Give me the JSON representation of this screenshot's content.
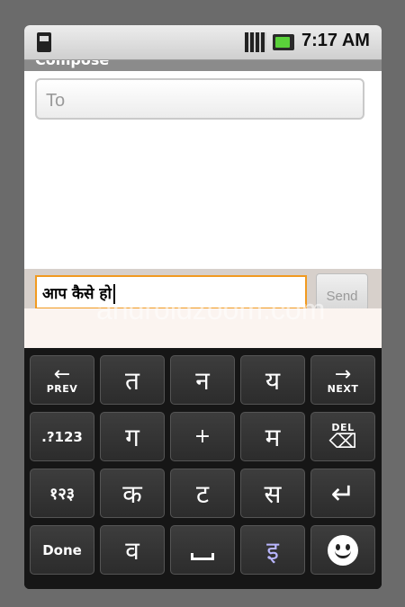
{
  "statusbar": {
    "time": "7:17 AM"
  },
  "title": {
    "text": "Compose"
  },
  "to_field": {
    "placeholder": "To"
  },
  "message": {
    "value": "आप कैसे हो"
  },
  "send_button": {
    "label": "Send"
  },
  "watermark": "androidzoom.com",
  "keyboard": {
    "row1": {
      "prev": "PREV",
      "k1": "त",
      "k2": "न",
      "k3": "य",
      "next": "NEXT"
    },
    "row2": {
      "sym": ".?123",
      "k1": "ग",
      "k2": "+",
      "k3": "म",
      "del": "DEL"
    },
    "row3": {
      "num": "१२३",
      "k1": "क",
      "k2": "ट",
      "k3": "स"
    },
    "row4": {
      "done": "Done",
      "k1": "व",
      "k3": "इ"
    }
  },
  "colors": {
    "accent_orange": "#f19a20",
    "battery_green": "#5ad13a",
    "key_bg": "#333333"
  }
}
